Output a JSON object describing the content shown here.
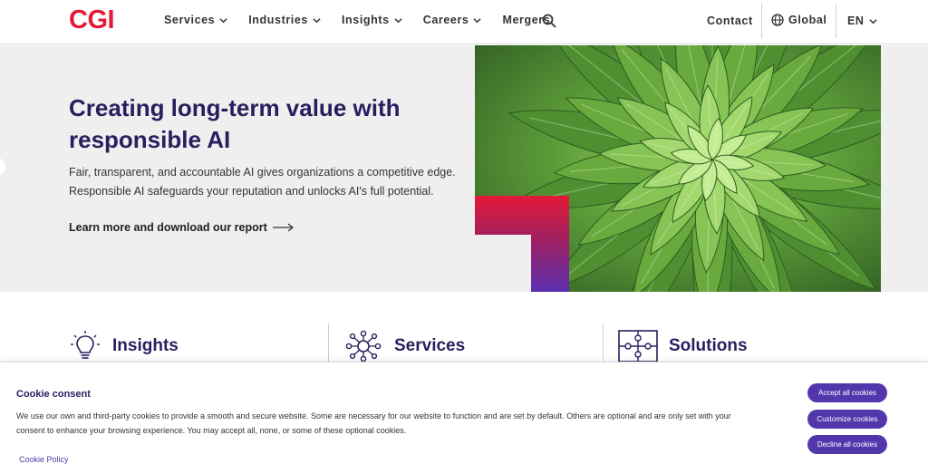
{
  "brand": {
    "logo_text": "CGI",
    "primary_color": "#e31937",
    "accent_color": "#5236ab",
    "heading_color": "#2b1d5e"
  },
  "header": {
    "nav": [
      {
        "label": "Services",
        "has_dropdown": true
      },
      {
        "label": "Industries",
        "has_dropdown": true
      },
      {
        "label": "Insights",
        "has_dropdown": true
      },
      {
        "label": "Careers",
        "has_dropdown": true
      },
      {
        "label": "Mergers",
        "has_dropdown": false
      }
    ],
    "search_icon": "search-icon",
    "contact_label": "Contact",
    "global_label": "Global",
    "language_label": "EN"
  },
  "hero": {
    "title": "Creating long-term value with responsible AI",
    "description": "Fair, transparent, and accountable AI gives organizations a competitive edge. Responsible AI safeguards your reputation and unlocks AI's full potential.",
    "cta_label": "Learn more and download our report",
    "image_subject": "agave plant rosette"
  },
  "features": [
    {
      "label": "Insights",
      "icon": "lightbulb-icon"
    },
    {
      "label": "Services",
      "icon": "network-icon"
    },
    {
      "label": "Solutions",
      "icon": "puzzle-icon"
    }
  ],
  "cookie": {
    "title": "Cookie consent",
    "text": "We use our own and third-party cookies to provide a smooth and secure website. Some are necessary for our website to function and are set by default. Others are optional and are only set with your consent to enhance your browsing experience. You may accept all, none, or some of these optional cookies.",
    "policy_link": "Cookie Policy",
    "buttons": {
      "accept": "Accept all cookies",
      "customize": "Customize cookies",
      "decline": "Decline all cookies"
    }
  }
}
